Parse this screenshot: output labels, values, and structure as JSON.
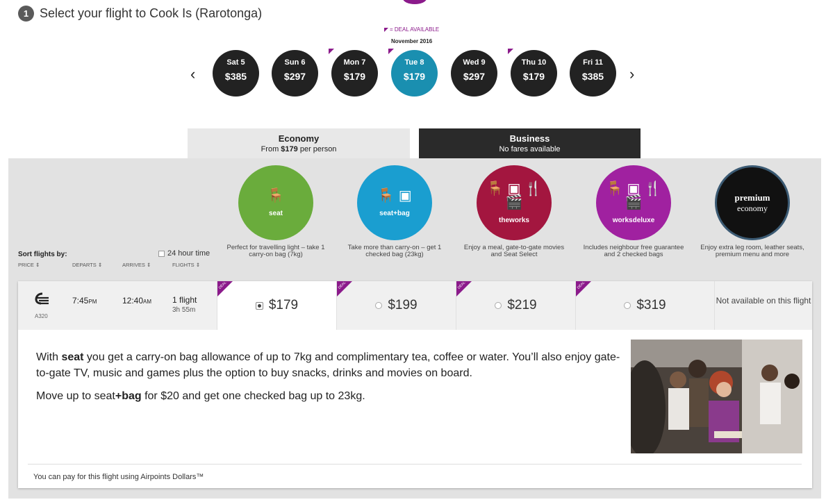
{
  "step": {
    "number": "1",
    "title": "Select your flight to Cook Is (Rarotonga)"
  },
  "deal_legend": "= DEAL AVAILABLE",
  "month": "November 2016",
  "nav": {
    "prev": "‹",
    "next": "›"
  },
  "dates": [
    {
      "day": "Sat 5",
      "price": "$385",
      "deal": false,
      "selected": false
    },
    {
      "day": "Sun 6",
      "price": "$297",
      "deal": false,
      "selected": false
    },
    {
      "day": "Mon 7",
      "price": "$179",
      "deal": true,
      "selected": false
    },
    {
      "day": "Tue 8",
      "price": "$179",
      "deal": true,
      "selected": true
    },
    {
      "day": "Wed 9",
      "price": "$297",
      "deal": false,
      "selected": false
    },
    {
      "day": "Thu 10",
      "price": "$179",
      "deal": true,
      "selected": false
    },
    {
      "day": "Fri 11",
      "price": "$385",
      "deal": false,
      "selected": false
    }
  ],
  "cabins": {
    "economy": {
      "title": "Economy",
      "sub_prefix": "From ",
      "sub_price": "$179",
      "sub_suffix": " per person"
    },
    "business": {
      "title": "Business",
      "sub": "No fares available"
    }
  },
  "fares": [
    {
      "name": "seat",
      "icon": "🪑",
      "color": "#6aac3c",
      "desc": "Perfect for travelling light – take 1 carry-on bag (7kg)"
    },
    {
      "name": "seat+bag",
      "icon": "🪑 ▣",
      "color": "#1a9ed0",
      "desc": "Take more than carry-on – get 1 checked bag (23kg)"
    },
    {
      "name": "theworks",
      "icon": "🪑 ▣ 🍴 🎬",
      "color": "#a3163f",
      "desc": "Enjoy a meal, gate-to-gate movies and Seat Select"
    },
    {
      "name": "worksdeluxe",
      "icon": "🪑 ▣ 🍴 🎬",
      "color": "#a021a0",
      "desc": "Includes neighbour free guarantee and 2 checked bags"
    },
    {
      "name_line1": "premium",
      "name_line2": "economy",
      "color": "#111111",
      "desc": "Enjoy extra leg room, leather seats, premium menu and more"
    }
  ],
  "sort": {
    "label": "Sort flights by:",
    "hour24": "24 hour time",
    "columns": [
      "PRICE ⇕",
      "DEPARTS ⇕",
      "ARRIVES ⇕",
      "FLIGHTS ⇕"
    ]
  },
  "flight": {
    "aircraft": "A320",
    "departs": "7:45",
    "departs_ampm": "PM",
    "arrives": "12:40",
    "arrives_ampm": "AM",
    "flights": "1 flight",
    "duration": "3h 55m",
    "prices": [
      "$179",
      "$199",
      "$219",
      "$319"
    ],
    "deal_label": "DEAL",
    "not_available": "Not available on this flight"
  },
  "details": {
    "p1_prefix": "With ",
    "p1_bold": "seat",
    "p1_rest": " you get a carry-on bag allowance of up to 7kg and complimentary tea, coffee or water. You’ll also enjoy gate-to-gate TV, music and games plus the option to buy snacks, drinks and movies on board.",
    "p2_prefix": "Move up to seat",
    "p2_bold": "+bag",
    "p2_rest": " for $20 and get one checked bag up to 23kg."
  },
  "airpoints": "You can pay for this flight using Airpoints Dollars™",
  "colors": {
    "deal": "#8b1a8b",
    "selected_date": "#1a8fb0",
    "date_bg": "#222222"
  }
}
